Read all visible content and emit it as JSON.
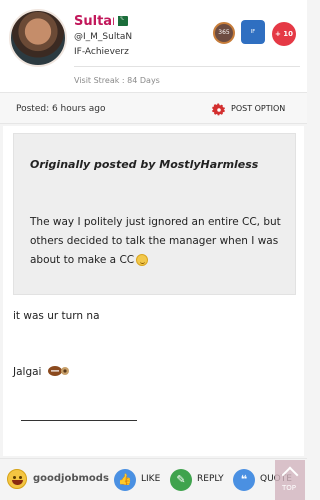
{
  "profile": {
    "username": "Sultan",
    "handle": "@I_M_SultaN",
    "rank": "IF-Achieverz",
    "visit_streak": "Visit Streak : 84 Days",
    "badges": {
      "days_badge": "365",
      "blue_badge": "IF",
      "more_badges": "+ 10"
    }
  },
  "post_meta": {
    "posted": "Posted: 6 hours ago",
    "option_label": "POST OPTION"
  },
  "quote": {
    "header": "Originally posted by MostlyHarmless",
    "text": "The way I politely just ignored an entire CC, but others decided to talk the manager when I was about to make a CC"
  },
  "post": {
    "line1": "it was ur turn na",
    "line2": "Jalgai"
  },
  "actions": {
    "reaction_label": "goodjobmods",
    "like": "LIKE",
    "reply": "REPLY",
    "quote": "QUOTE",
    "top": "TOP"
  },
  "colors": {
    "username": "#c2185b",
    "like_blue": "#4a90e2",
    "reply_green": "#3fa34d",
    "badge_red": "#e53945"
  }
}
